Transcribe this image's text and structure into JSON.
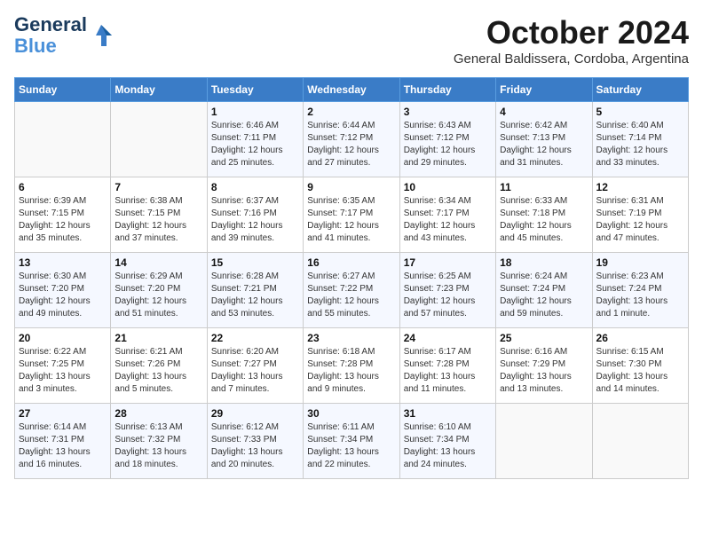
{
  "header": {
    "logo_line1": "General",
    "logo_line2": "Blue",
    "month": "October 2024",
    "location": "General Baldissera, Cordoba, Argentina"
  },
  "weekdays": [
    "Sunday",
    "Monday",
    "Tuesday",
    "Wednesday",
    "Thursday",
    "Friday",
    "Saturday"
  ],
  "weeks": [
    [
      {
        "day": "",
        "detail": ""
      },
      {
        "day": "",
        "detail": ""
      },
      {
        "day": "1",
        "detail": "Sunrise: 6:46 AM\nSunset: 7:11 PM\nDaylight: 12 hours and 25 minutes."
      },
      {
        "day": "2",
        "detail": "Sunrise: 6:44 AM\nSunset: 7:12 PM\nDaylight: 12 hours and 27 minutes."
      },
      {
        "day": "3",
        "detail": "Sunrise: 6:43 AM\nSunset: 7:12 PM\nDaylight: 12 hours and 29 minutes."
      },
      {
        "day": "4",
        "detail": "Sunrise: 6:42 AM\nSunset: 7:13 PM\nDaylight: 12 hours and 31 minutes."
      },
      {
        "day": "5",
        "detail": "Sunrise: 6:40 AM\nSunset: 7:14 PM\nDaylight: 12 hours and 33 minutes."
      }
    ],
    [
      {
        "day": "6",
        "detail": "Sunrise: 6:39 AM\nSunset: 7:15 PM\nDaylight: 12 hours and 35 minutes."
      },
      {
        "day": "7",
        "detail": "Sunrise: 6:38 AM\nSunset: 7:15 PM\nDaylight: 12 hours and 37 minutes."
      },
      {
        "day": "8",
        "detail": "Sunrise: 6:37 AM\nSunset: 7:16 PM\nDaylight: 12 hours and 39 minutes."
      },
      {
        "day": "9",
        "detail": "Sunrise: 6:35 AM\nSunset: 7:17 PM\nDaylight: 12 hours and 41 minutes."
      },
      {
        "day": "10",
        "detail": "Sunrise: 6:34 AM\nSunset: 7:17 PM\nDaylight: 12 hours and 43 minutes."
      },
      {
        "day": "11",
        "detail": "Sunrise: 6:33 AM\nSunset: 7:18 PM\nDaylight: 12 hours and 45 minutes."
      },
      {
        "day": "12",
        "detail": "Sunrise: 6:31 AM\nSunset: 7:19 PM\nDaylight: 12 hours and 47 minutes."
      }
    ],
    [
      {
        "day": "13",
        "detail": "Sunrise: 6:30 AM\nSunset: 7:20 PM\nDaylight: 12 hours and 49 minutes."
      },
      {
        "day": "14",
        "detail": "Sunrise: 6:29 AM\nSunset: 7:20 PM\nDaylight: 12 hours and 51 minutes."
      },
      {
        "day": "15",
        "detail": "Sunrise: 6:28 AM\nSunset: 7:21 PM\nDaylight: 12 hours and 53 minutes."
      },
      {
        "day": "16",
        "detail": "Sunrise: 6:27 AM\nSunset: 7:22 PM\nDaylight: 12 hours and 55 minutes."
      },
      {
        "day": "17",
        "detail": "Sunrise: 6:25 AM\nSunset: 7:23 PM\nDaylight: 12 hours and 57 minutes."
      },
      {
        "day": "18",
        "detail": "Sunrise: 6:24 AM\nSunset: 7:24 PM\nDaylight: 12 hours and 59 minutes."
      },
      {
        "day": "19",
        "detail": "Sunrise: 6:23 AM\nSunset: 7:24 PM\nDaylight: 13 hours and 1 minute."
      }
    ],
    [
      {
        "day": "20",
        "detail": "Sunrise: 6:22 AM\nSunset: 7:25 PM\nDaylight: 13 hours and 3 minutes."
      },
      {
        "day": "21",
        "detail": "Sunrise: 6:21 AM\nSunset: 7:26 PM\nDaylight: 13 hours and 5 minutes."
      },
      {
        "day": "22",
        "detail": "Sunrise: 6:20 AM\nSunset: 7:27 PM\nDaylight: 13 hours and 7 minutes."
      },
      {
        "day": "23",
        "detail": "Sunrise: 6:18 AM\nSunset: 7:28 PM\nDaylight: 13 hours and 9 minutes."
      },
      {
        "day": "24",
        "detail": "Sunrise: 6:17 AM\nSunset: 7:28 PM\nDaylight: 13 hours and 11 minutes."
      },
      {
        "day": "25",
        "detail": "Sunrise: 6:16 AM\nSunset: 7:29 PM\nDaylight: 13 hours and 13 minutes."
      },
      {
        "day": "26",
        "detail": "Sunrise: 6:15 AM\nSunset: 7:30 PM\nDaylight: 13 hours and 14 minutes."
      }
    ],
    [
      {
        "day": "27",
        "detail": "Sunrise: 6:14 AM\nSunset: 7:31 PM\nDaylight: 13 hours and 16 minutes."
      },
      {
        "day": "28",
        "detail": "Sunrise: 6:13 AM\nSunset: 7:32 PM\nDaylight: 13 hours and 18 minutes."
      },
      {
        "day": "29",
        "detail": "Sunrise: 6:12 AM\nSunset: 7:33 PM\nDaylight: 13 hours and 20 minutes."
      },
      {
        "day": "30",
        "detail": "Sunrise: 6:11 AM\nSunset: 7:34 PM\nDaylight: 13 hours and 22 minutes."
      },
      {
        "day": "31",
        "detail": "Sunrise: 6:10 AM\nSunset: 7:34 PM\nDaylight: 13 hours and 24 minutes."
      },
      {
        "day": "",
        "detail": ""
      },
      {
        "day": "",
        "detail": ""
      }
    ]
  ]
}
